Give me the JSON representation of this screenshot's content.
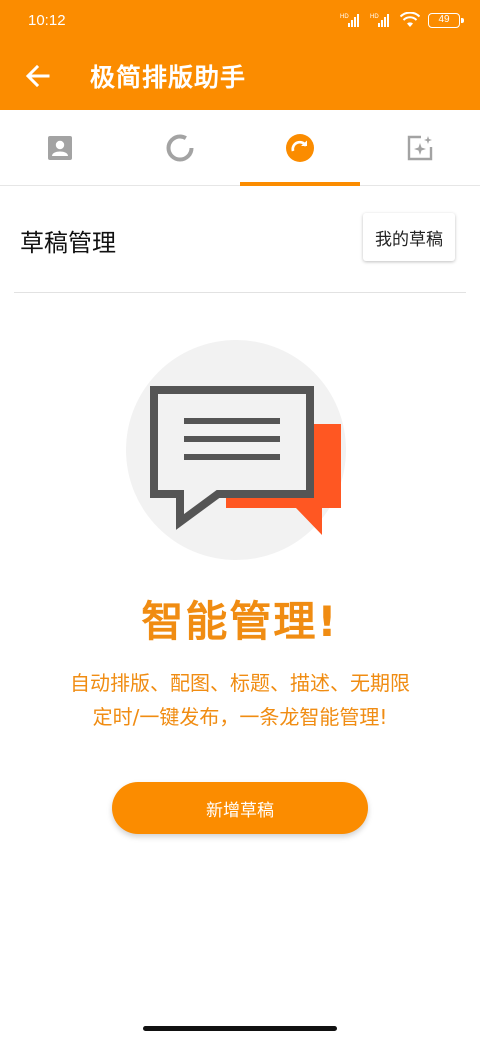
{
  "status": {
    "time": "10:12",
    "battery": "49",
    "signal1_label": "HD",
    "signal2_label": "HD"
  },
  "appbar": {
    "title": "极简排版助手",
    "back_icon": "arrow-left-icon"
  },
  "tabs": [
    {
      "icon": "contact-card-icon",
      "active": false
    },
    {
      "icon": "ring-icon",
      "active": false
    },
    {
      "icon": "redo-circle-icon",
      "active": true
    },
    {
      "icon": "sparkle-frame-icon",
      "active": false
    }
  ],
  "section": {
    "title": "草稿管理",
    "drafts_button": "我的草稿"
  },
  "promo": {
    "headline": "智能管理!",
    "desc_line1": "自动排版、配图、标题、描述、无期限",
    "desc_line2": "定时/一键发布，一条龙智能管理!"
  },
  "cta": {
    "label": "新增草稿"
  },
  "colors": {
    "brand": "#fb8c00",
    "accent_text": "#f08c12",
    "bubble_orange": "#ff5722",
    "bubble_gray": "#555555"
  }
}
